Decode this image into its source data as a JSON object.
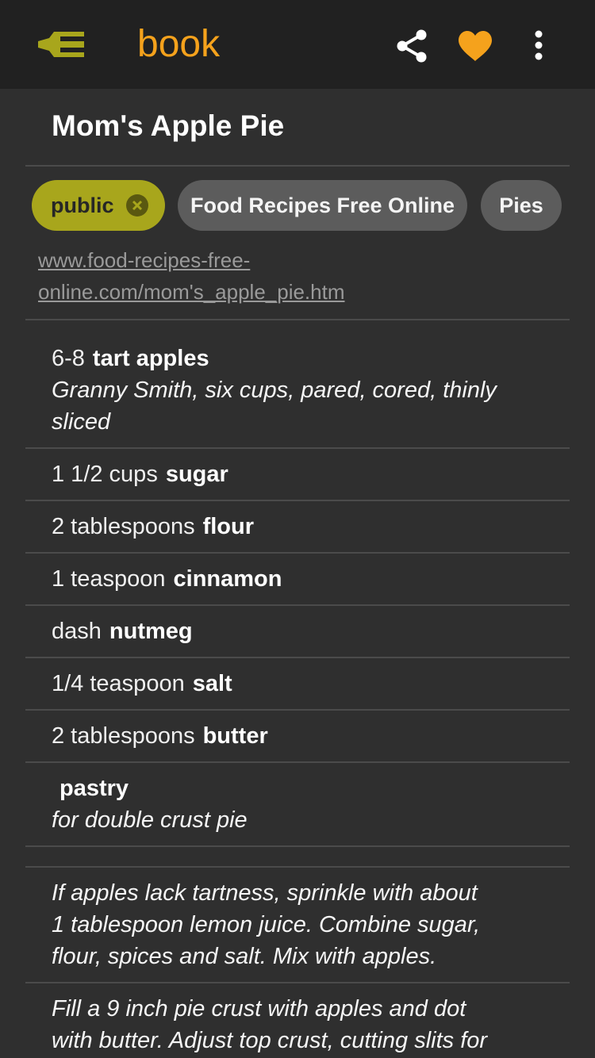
{
  "app": {
    "title": "book",
    "accent_color": "#f5a21c",
    "logo_icon": "fork-logo-icon"
  },
  "toolbar": {
    "share_icon": "share-icon",
    "favorite_icon": "heart-icon",
    "menu_icon": "more-vert-icon"
  },
  "recipe": {
    "title": "Mom's Apple Pie",
    "tags": [
      {
        "label": "public",
        "removable": true
      },
      {
        "label": "Food Recipes Free Online"
      },
      {
        "label": "Pies"
      }
    ],
    "source_line1": "www.food-recipes-free-",
    "source_line2": "online.com/mom's_apple_pie.htm",
    "ingredients": [
      {
        "qty": "6-8",
        "name": "tart apples",
        "note_line1": "Granny Smith, six cups, pared, cored, thinly",
        "note_line2": "sliced"
      },
      {
        "qty": "1 1/2 cups",
        "name": "sugar"
      },
      {
        "qty": "2 tablespoons",
        "name": "flour"
      },
      {
        "qty": "1 teaspoon",
        "name": "cinnamon"
      },
      {
        "qty": "dash",
        "name": "nutmeg"
      },
      {
        "qty": "1/4 teaspoon",
        "name": "salt"
      },
      {
        "qty": "2 tablespoons",
        "name": "butter"
      },
      {
        "qty": "",
        "name": "pastry",
        "note_line1": "for double crust pie"
      }
    ],
    "steps": [
      {
        "line1": "If apples lack tartness, sprinkle with about",
        "line2": "1 tablespoon lemon juice. Combine sugar,",
        "line3": "flour, spices and salt. Mix with apples."
      },
      {
        "line1": "Fill a 9 inch pie crust with apples and dot",
        "line2": "with butter. Adjust top crust, cutting slits for"
      }
    ]
  }
}
